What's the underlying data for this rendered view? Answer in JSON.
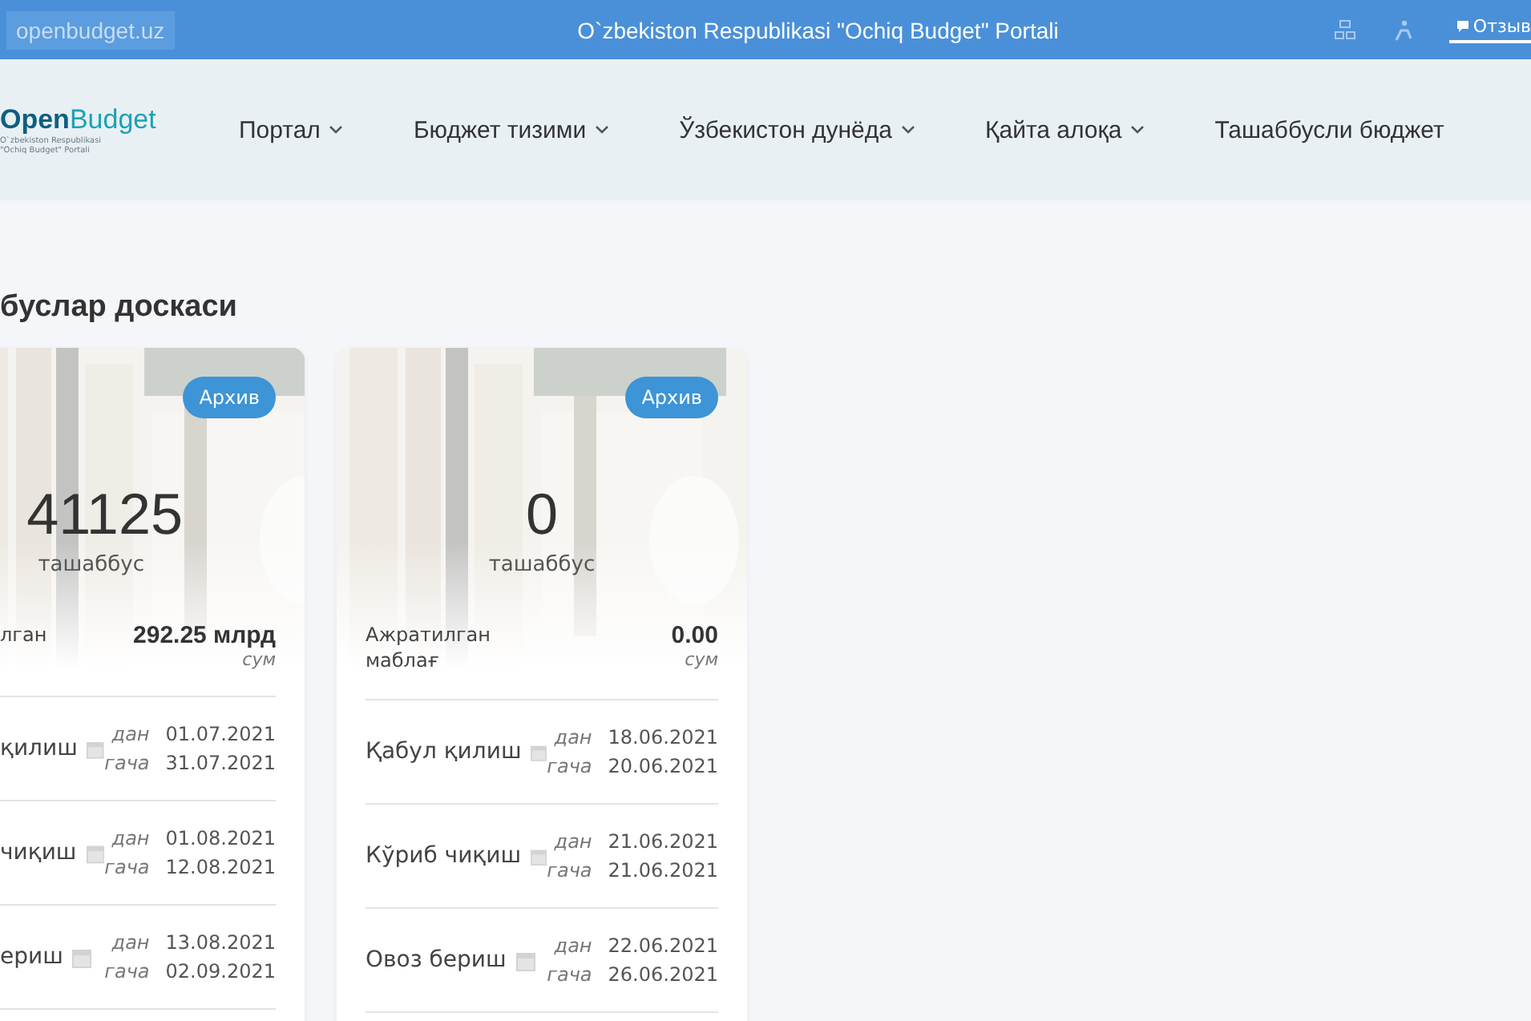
{
  "top_bar": {
    "site": "openbudget.uz",
    "title": "O`zbekiston Respublikasi \"Ochiq Budget\" Portali",
    "feedback": "Отзыв"
  },
  "nav": {
    "logo": {
      "bold": "Open",
      "light": "Budget",
      "subtitle": "O`zbekiston Respublikasi \"Ochiq Budget\" Portali"
    },
    "items": [
      {
        "label": "Портал",
        "dropdown": true
      },
      {
        "label": "Бюджет тизими",
        "dropdown": true
      },
      {
        "label": "Ўзбекистон дунёда",
        "dropdown": true
      },
      {
        "label": "Қайта алоқа",
        "dropdown": true
      },
      {
        "label": "Ташаббусли бюджет",
        "dropdown": false
      }
    ]
  },
  "heading": "буслар доскаси",
  "cards": [
    {
      "cut": true,
      "badge": "Архив",
      "count": "41125",
      "count_label": "ташаббус",
      "funds_label": "лган",
      "funds_value": "292.25 млрд",
      "funds_unit": "сум",
      "stages": [
        {
          "name": "қилиш",
          "from_label": "дан",
          "from": "01.07.2021",
          "to_label": "гача",
          "to": "31.07.2021"
        },
        {
          "name": "чиқиш",
          "from_label": "дан",
          "from": "01.08.2021",
          "to_label": "гача",
          "to": "12.08.2021"
        },
        {
          "name": "ериш",
          "from_label": "дан",
          "from": "13.08.2021",
          "to_label": "гача",
          "to": "02.09.2021"
        }
      ]
    },
    {
      "cut": false,
      "badge": "Архив",
      "count": "0",
      "count_label": "ташаббус",
      "funds_label": "Ажратилган маблағ",
      "funds_value": "0.00",
      "funds_unit": "сум",
      "stages": [
        {
          "name": "Қабул қилиш",
          "from_label": "дан",
          "from": "18.06.2021",
          "to_label": "гача",
          "to": "20.06.2021"
        },
        {
          "name": "Кўриб чиқиш",
          "from_label": "дан",
          "from": "21.06.2021",
          "to_label": "гача",
          "to": "21.06.2021"
        },
        {
          "name": "Овоз бериш",
          "from_label": "дан",
          "from": "22.06.2021",
          "to_label": "гача",
          "to": "26.06.2021"
        }
      ]
    }
  ]
}
